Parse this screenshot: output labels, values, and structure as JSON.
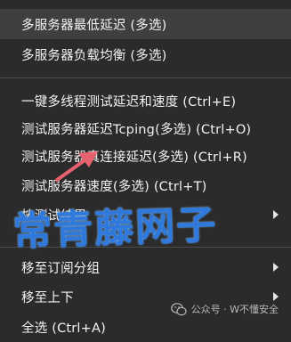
{
  "menu": {
    "items": [
      {
        "label": "多服务器最低延迟 (多选)"
      },
      {
        "label": "多服务器负载均衡 (多选)"
      },
      {
        "label": "一键多线程测试延迟和速度 (Ctrl+E)"
      },
      {
        "label": "测试服务器延迟Tcping(多选) (Ctrl+O)"
      },
      {
        "label": "测试服务器真连接延迟(多选) (Ctrl+R)"
      },
      {
        "label": "测试服务器速度(多选) (Ctrl+T)"
      },
      {
        "label": "按测试结果"
      },
      {
        "label": "移至订阅分组"
      },
      {
        "label": "移至上下"
      },
      {
        "label": "全选 (Ctrl+A)"
      }
    ]
  },
  "watermark": {
    "text": "常青藤网子",
    "credit": "公众号 · W不懂安全"
  },
  "icons": {
    "submenu": "chevron-right-icon",
    "pointer": "arrow-pointer-icon",
    "credit": "wechat-icon"
  },
  "colors": {
    "menu_bg": "#2b2b2b",
    "hover_bg": "#3f3f3f",
    "separator": "#4d4d4d",
    "text": "#f2f2f2",
    "watermark": "#2f78dc",
    "pointer": "#e8616e"
  }
}
